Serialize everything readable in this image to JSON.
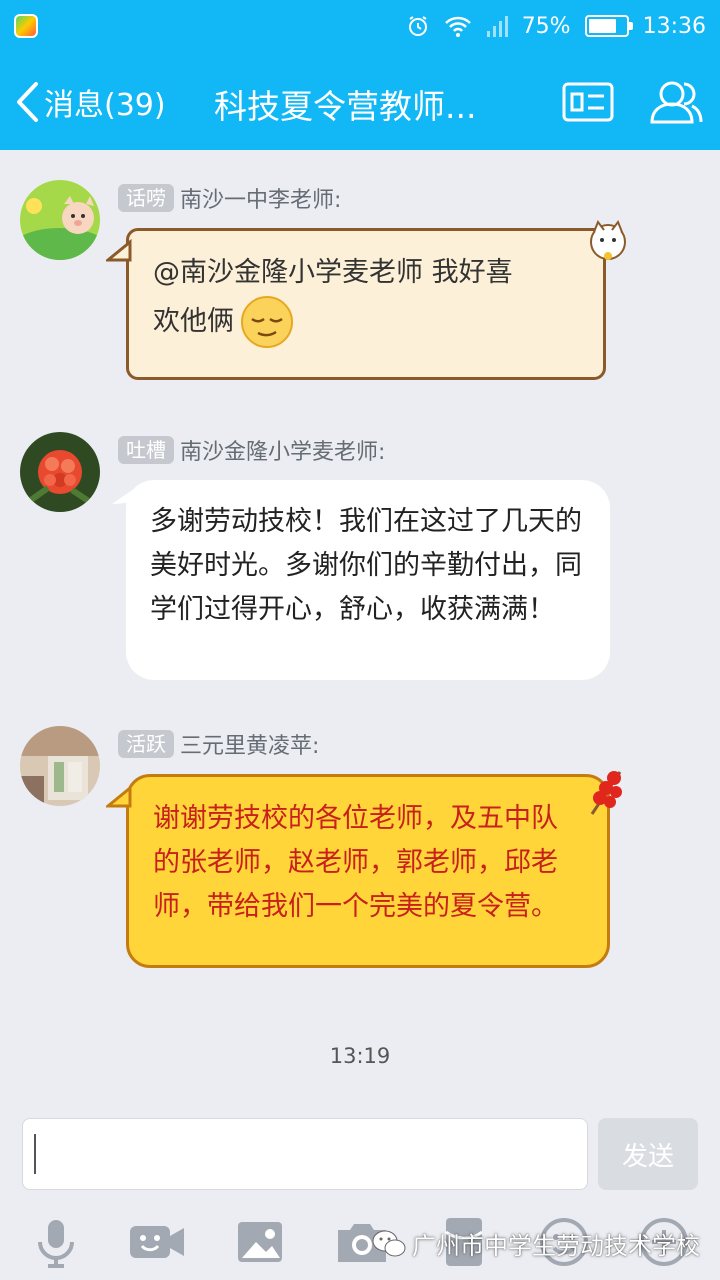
{
  "status_bar": {
    "battery_percent": "75%",
    "battery_level": 0.75,
    "time": "13:36"
  },
  "header": {
    "back_label": "消息(39)",
    "title": "科技夏令营教师...",
    "icons": [
      "back-chevron-icon",
      "group-profile-card-icon",
      "group-members-icon"
    ]
  },
  "messages": [
    {
      "badge": "话唠",
      "sender": "南沙一中李老师:",
      "line1": "@南沙金隆小学麦老师 我好喜",
      "line2": "欢他俩",
      "emoji": "smirk-emoji-icon",
      "bubble_style": "parchment",
      "bubble_color": "#fdf0d8"
    },
    {
      "badge": "吐槽",
      "sender": "南沙金隆小学麦老师:",
      "text": "多谢劳动技校！我们在这过了几天的美好时光。多谢你们的辛勤付出，同学们过得开心，舒心，收获满满！",
      "bubble_style": "white",
      "bubble_color": "#ffffff"
    },
    {
      "badge": "活跃",
      "sender": "三元里黄凌苹:",
      "text": "谢谢劳技校的各位老师，及五中队的张老师，赵老师，郭老师，邱老师，带给我们一个完美的夏令营。",
      "bubble_style": "yellow",
      "bubble_color": "#ffd53a",
      "text_color": "#c8211c"
    }
  ],
  "time_divider": "13:19",
  "input": {
    "value": "",
    "send_label": "发送"
  },
  "toolbar": {
    "icons": [
      "microphone-icon",
      "video-call-icon",
      "image-icon",
      "camera-icon",
      "red-packet-icon",
      "emoji-icon",
      "plus-icon"
    ]
  },
  "watermark": "广州市中学生劳动技术学校",
  "colors": {
    "accent": "#12b7f5",
    "background": "#ebedf2"
  }
}
